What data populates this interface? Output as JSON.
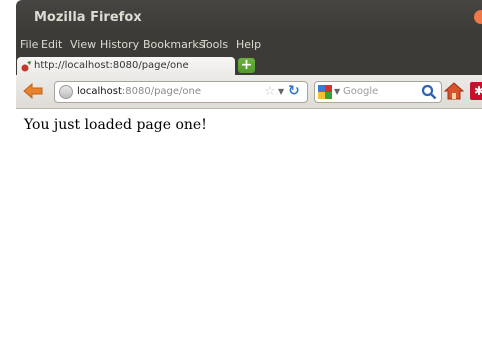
{
  "window": {
    "title": "Mozilla Firefox"
  },
  "menu": [
    "File",
    "Edit",
    "View",
    "History",
    "Bookmarks",
    "Tools",
    "Help"
  ],
  "tab": {
    "label": "http://localhost:8080/page/one"
  },
  "url": {
    "host": "localhost",
    "rest": ":8080/page/one"
  },
  "search": {
    "placeholder": "Google"
  },
  "page": {
    "text": "You just loaded page one!"
  },
  "colors": {
    "titlebar": "#3c3b37",
    "close_button": "#f07746",
    "reload_blue": "#3a76c8"
  },
  "icons": [
    "firefox-favicon",
    "new-tab-plus",
    "back-arrow",
    "site-identity",
    "bookmark-star",
    "reload",
    "google-engine",
    "search-magnifier",
    "home",
    "addon-red"
  ]
}
